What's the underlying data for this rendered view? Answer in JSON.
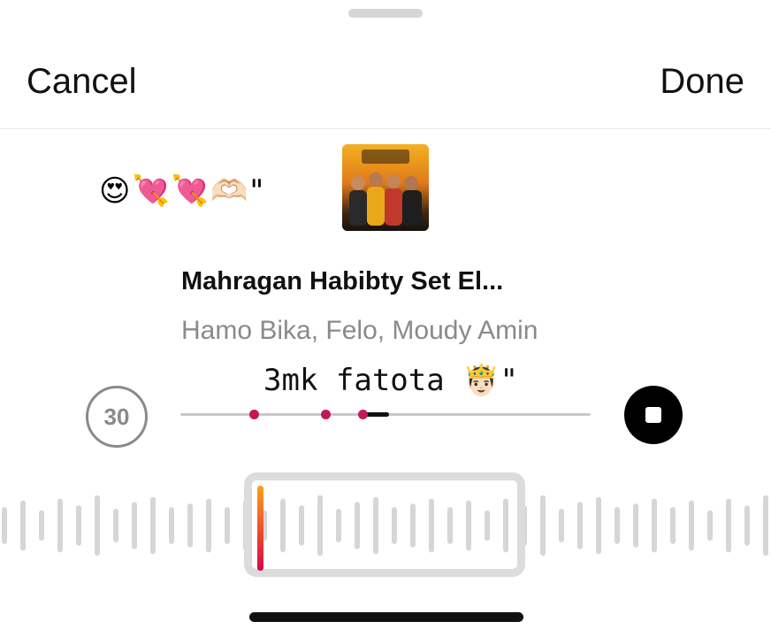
{
  "header": {
    "cancel_label": "Cancel",
    "done_label": "Done"
  },
  "sticker": {
    "emoji_text": "😍💘💘🫶🏻\""
  },
  "track": {
    "title": "Mahragan Habibty Set El...",
    "artists": "Hamo Bika, Felo, Moudy Amin"
  },
  "lyric": {
    "text": "3mk fatota 🤴🏻\""
  },
  "player": {
    "duration_label": "30",
    "progress_markers": [
      0.18,
      0.355,
      0.445
    ],
    "played_fraction_start": 0.445,
    "played_fraction_end": 0.508
  },
  "colors": {
    "accent": "#c2185b",
    "marker_gradient_top": "#f7a21b",
    "marker_gradient_bottom": "#d10a4e",
    "text_primary": "#111111",
    "text_secondary": "#8a8a8a"
  },
  "icons": {
    "stop": "stop-icon",
    "cover": "album-cover"
  }
}
